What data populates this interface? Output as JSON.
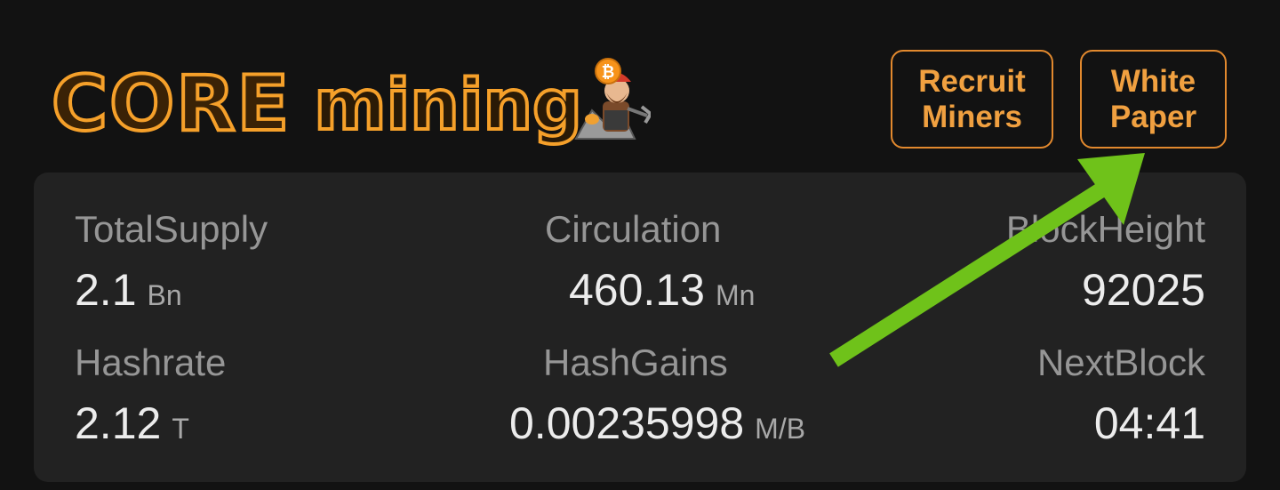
{
  "header": {
    "logo": {
      "word1": "CORE",
      "word2": "mining"
    },
    "buttons": {
      "recruit": {
        "line1": "Recruit",
        "line2": "Miners"
      },
      "whitepaper": {
        "line1": "White",
        "line2": "Paper"
      }
    }
  },
  "stats": {
    "total_supply": {
      "label": "TotalSupply",
      "value": "2.1",
      "unit": "Bn"
    },
    "circulation": {
      "label": "Circulation",
      "value": "460.13",
      "unit": "Mn"
    },
    "block_height": {
      "label": "BlockHeight",
      "value": "92025"
    },
    "hashrate": {
      "label": "Hashrate",
      "value": "2.12",
      "unit": "T"
    },
    "hash_gains": {
      "label": "HashGains",
      "value": "0.00235998",
      "unit": "M/B"
    },
    "next_block": {
      "label": "NextBlock",
      "value": "04:41"
    }
  },
  "colors": {
    "accent": "#f5a02a",
    "arrow": "#6fc21a",
    "panel": "#222222",
    "background": "#121212"
  },
  "icons": [
    "miner-mascot-icon",
    "bitcoin-coin-icon",
    "arrow-annotation-icon"
  ]
}
